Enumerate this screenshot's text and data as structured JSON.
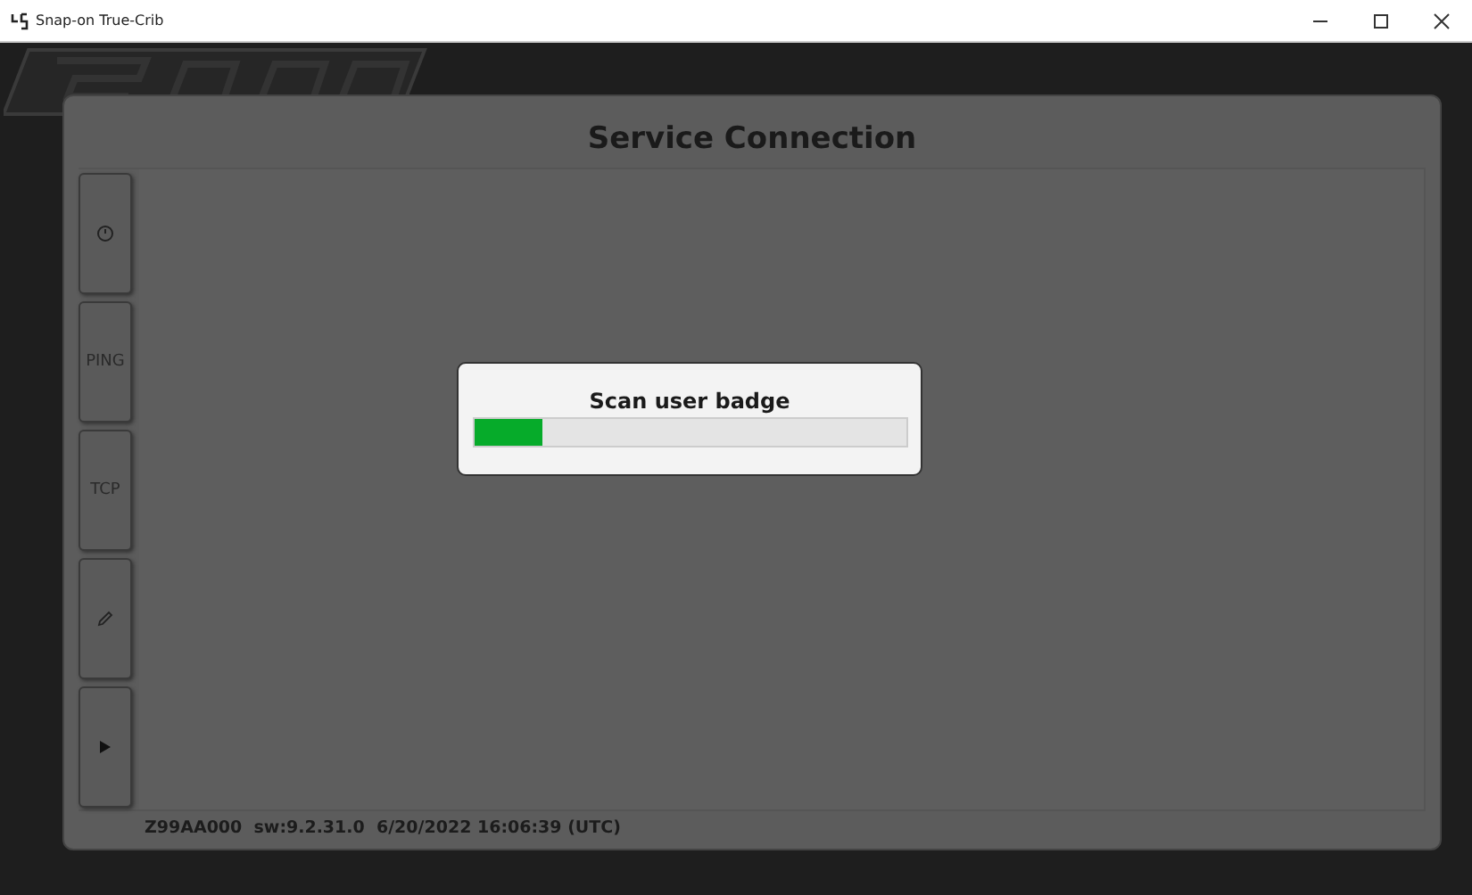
{
  "window": {
    "title": "Snap-on True-Crib"
  },
  "panel": {
    "title": "Service Connection"
  },
  "side_buttons": [
    {
      "kind": "clock"
    },
    {
      "kind": "text",
      "label": "PING"
    },
    {
      "kind": "text",
      "label": "TCP"
    },
    {
      "kind": "pencil"
    },
    {
      "kind": "play"
    }
  ],
  "status_bar": {
    "text": "Z99AA000  sw:9.2.31.0  6/20/2022 16:06:39 (UTC)"
  },
  "dialog": {
    "message": "Scan user badge",
    "level": 0.16
  }
}
